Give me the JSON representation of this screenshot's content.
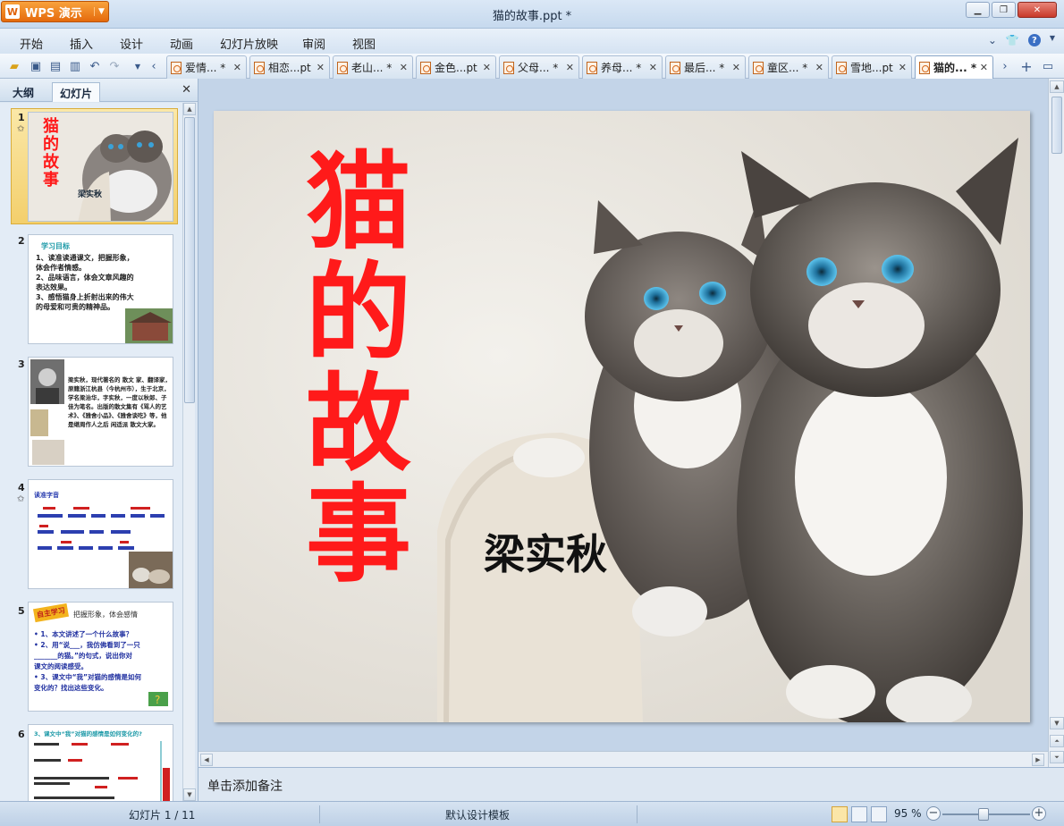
{
  "app": {
    "name": "WPS 演示",
    "window_title": "猫的故事.ppt *"
  },
  "menu": [
    "开始",
    "插入",
    "设计",
    "动画",
    "幻灯片放映",
    "审阅",
    "视图"
  ],
  "tabs": [
    {
      "label": "爱情... *"
    },
    {
      "label": "相恋...pt"
    },
    {
      "label": "老山... *"
    },
    {
      "label": "金色...pt"
    },
    {
      "label": "父母... *"
    },
    {
      "label": "养母... *"
    },
    {
      "label": "最后... *"
    },
    {
      "label": "童区... *"
    },
    {
      "label": "雪地...pt"
    },
    {
      "label": "猫的... *"
    }
  ],
  "panel": {
    "tab_outline": "大纲",
    "tab_slides": "幻灯片"
  },
  "thumbnails": [
    {
      "num": "1",
      "title": "猫的故事",
      "author": "梁实秋"
    },
    {
      "num": "2",
      "heading": "学习目标",
      "lines": [
        "1、读准读通课文，把握形象，",
        "体会作者情感。",
        "2、品味语言，体会文章风趣的",
        "表达效果。",
        "3、感悟猫身上折射出来的伟大",
        "的母爱和可贵的精神品。"
      ]
    },
    {
      "num": "3",
      "text": "梁实秋，现代著名的 散文 家、翻译家，原籍浙江杭县（今杭州市），生于北京，学名梁治华，字实秋，一度以秋郎、子佳为笔名。出版的散文集有《骂人的艺术》、《雅舍小品》、《雅舍谈吃》等，他是继周作人之后 闲适派 散文大家。"
    },
    {
      "num": "4",
      "heading": "读准字音"
    },
    {
      "num": "5",
      "heading": "自主学习",
      "subtitle": "把握形象，体会感情",
      "lines": [
        "• 1、本文讲述了一个什么故事？",
        "• 2、用“说___，我仿佛看到了一只",
        "_______的猫。”的句式，说出你对",
        "课文的阅读感受。",
        "• 3、课文中“我”对猫的感情是如何",
        "变化的？找出这些变化。"
      ]
    },
    {
      "num": "6",
      "heading": "3、课文中“我”对猫的感情是如何变化的?"
    }
  ],
  "slide": {
    "title": "猫的故事",
    "author": "梁实秋"
  },
  "notes_placeholder": "单击添加备注",
  "status": {
    "slide_counter": "幻灯片 1 / 11",
    "template": "默认设计模板",
    "zoom": "95 %"
  },
  "colors": {
    "title_red": "#ff1a1a",
    "wps_orange": "#e56a0c",
    "selection_yellow": "#f3cf6c"
  }
}
